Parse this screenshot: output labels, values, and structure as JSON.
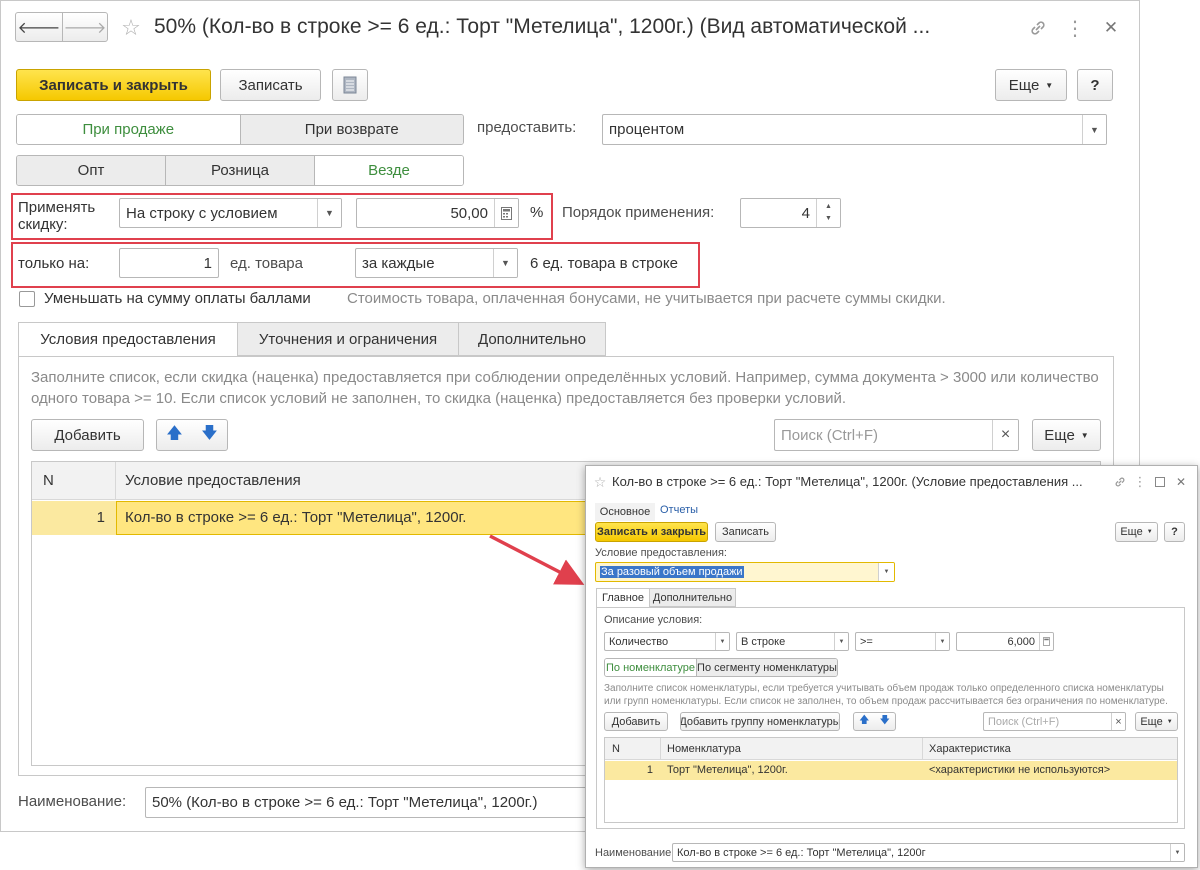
{
  "window": {
    "title": "50% (Кол-во в строке >= 6 ед.: Торт \"Метелица\", 1200г.) (Вид автоматической ...",
    "back_glyph": "🡐",
    "fwd_glyph": "🡒",
    "star_glyph": "☆",
    "link_glyph": "🔗",
    "menu_glyph": "⋮",
    "close_glyph": "✕"
  },
  "toolbar": {
    "save_close": "Записать и закрыть",
    "save": "Записать",
    "more": "Еще",
    "help": "?"
  },
  "mode": {
    "sale": "При продаже",
    "return": "При возврате",
    "provide_label": "предоставить:",
    "provide_value": "процентом"
  },
  "channel": {
    "opt": "Опт",
    "retail": "Розница",
    "everywhere": "Везде"
  },
  "apply": {
    "label": "Применять скидку:",
    "value": "На строку с условием",
    "amount": "50,00",
    "percent": "%",
    "order_label": "Порядок применения:",
    "order_value": "4"
  },
  "only": {
    "label": "только на:",
    "qty": "1",
    "unit": "ед. товара",
    "each": "за каждые",
    "summary": "6 ед. товара в строке"
  },
  "bonus": {
    "checkbox_label": "Уменьшать на сумму оплаты баллами",
    "note": "Стоимость товара, оплаченная бонусами, не учитывается при расчете суммы скидки."
  },
  "tabs": {
    "conditions": "Условия предоставления",
    "refinements": "Уточнения и ограничения",
    "extra": "Дополнительно"
  },
  "conditions": {
    "hint": "Заполните список, если скидка (наценка) предоставляется при соблюдении определённых условий. Например, сумма документа > 3000 или количество одного товара >= 10. Если список условий не заполнен, то скидка (наценка) предоставляется без проверки условий.",
    "add": "Добавить",
    "search_placeholder": "Поиск (Ctrl+F)",
    "clear": "×",
    "more": "Еще",
    "col_n": "N",
    "col_condition": "Условие предоставления",
    "rows": [
      {
        "n": "1",
        "condition": "Кол-во в строке >= 6 ед.: Торт \"Метелица\", 1200г."
      }
    ]
  },
  "name": {
    "label": "Наименование:",
    "value": "50% (Кол-во в строке >= 6 ед.: Торт \"Метелица\", 1200г.)"
  },
  "popup": {
    "title": "Кол-во в строке >= 6 ед.: Торт \"Метелица\", 1200г. (Условие предоставления ...",
    "nav_main": "Основное",
    "nav_reports": "Отчеты",
    "save_close": "Записать и закрыть",
    "save": "Записать",
    "more": "Еще",
    "help": "?",
    "cond_label": "Условие предоставления:",
    "cond_value": "За разовый объем продажи",
    "tab_main": "Главное",
    "tab_extra": "Дополнительно",
    "desc_label": "Описание условия:",
    "f_qty": "Количество",
    "f_inrow": "В строке",
    "f_op": ">=",
    "f_value": "6,000",
    "sub_by_nom": "По номенклатуре",
    "sub_by_seg": "По сегменту номенклатуры",
    "hint": "Заполните список номенклатуры, если требуется учитывать объем продаж только определенного списка номенклатуры или групп номенклатуры. Если список не заполнен, то объем продаж рассчитывается без ограничения по номенклатуре.",
    "add": "Добавить",
    "add_group": "Добавить группу номенклатуры",
    "search_placeholder": "Поиск (Ctrl+F)",
    "clear": "×",
    "more2": "Еще",
    "col_n": "N",
    "col_nom": "Номенклатура",
    "col_char": "Характеристика",
    "rows": [
      {
        "n": "1",
        "nom": "Торт \"Метелица\", 1200г.",
        "char": "<характеристики не используются>"
      }
    ],
    "name_label": "Наименование:",
    "name_value": "Кол-во в строке >= 6 ед.: Торт \"Метелица\", 1200г"
  },
  "colors": {
    "accent_yellow": "#f5c800",
    "highlight_red": "#e0404d",
    "selected_row": "#fbe9a0",
    "green_text": "#3e8e3e"
  }
}
